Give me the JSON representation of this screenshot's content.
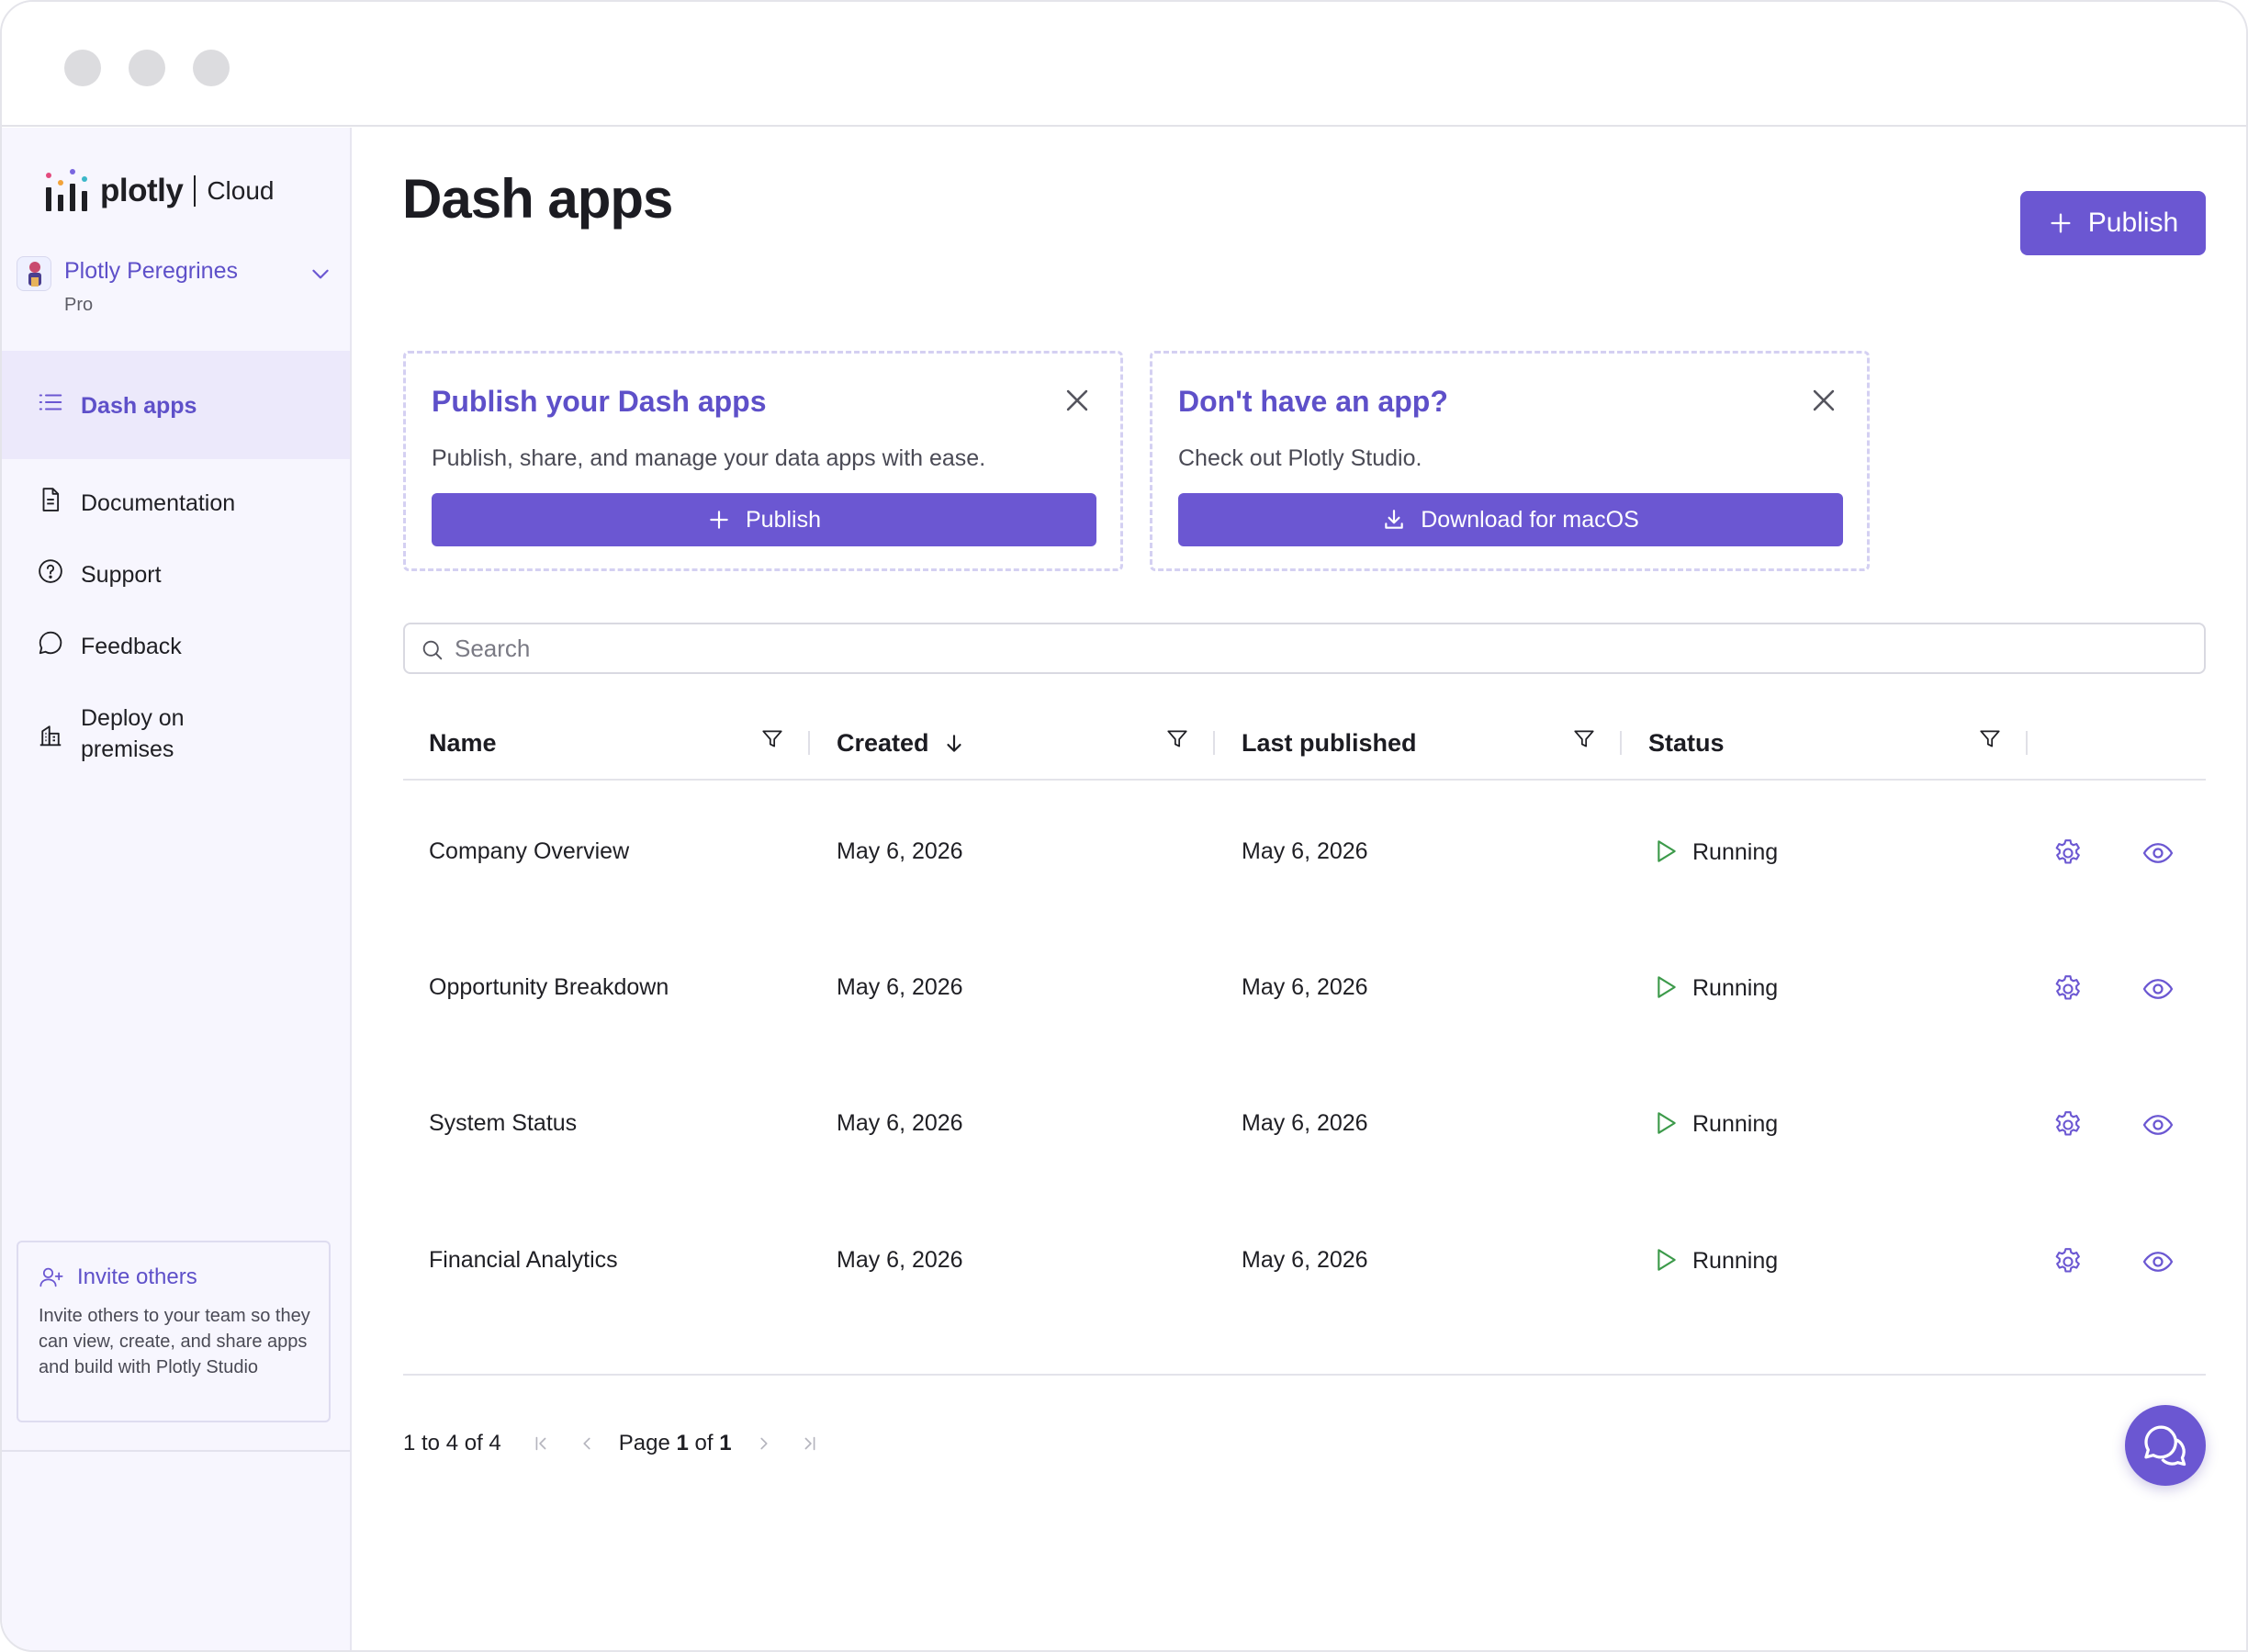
{
  "brand": {
    "logo_word": "plotly",
    "logo_product": "Cloud",
    "accent": "#6b57d2",
    "accent_text": "#5e50c9",
    "running_color": "#3c9a4a"
  },
  "team": {
    "name": "Plotly Peregrines",
    "plan": "Pro"
  },
  "sidebar": {
    "items": [
      {
        "label": "Dash apps",
        "icon": "list-icon"
      },
      {
        "label": "Documentation",
        "icon": "document-icon"
      },
      {
        "label": "Support",
        "icon": "help-circle-icon"
      },
      {
        "label": "Feedback",
        "icon": "chat-bubble-icon"
      },
      {
        "label": "Deploy on premises",
        "icon": "building-icon"
      }
    ],
    "invite": {
      "title": "Invite others",
      "text": "Invite others to your team so they can view, create, and share apps and build with Plotly Studio"
    }
  },
  "header": {
    "title": "Dash apps",
    "publish_label": "Publish"
  },
  "cards": [
    {
      "title": "Publish your Dash apps",
      "text": "Publish, share, and manage your data apps with ease.",
      "button": "Publish",
      "button_icon": "plus-icon"
    },
    {
      "title": "Don't have an app?",
      "text": "Check out Plotly Studio.",
      "button": "Download for macOS",
      "button_icon": "download-icon"
    }
  ],
  "search": {
    "placeholder": "Search",
    "value": ""
  },
  "table": {
    "columns": [
      "Name",
      "Created",
      "Last published",
      "Status"
    ],
    "sort": {
      "column": "Created",
      "direction": "desc"
    },
    "rows": [
      {
        "name": "Company Overview",
        "created": "May 6, 2026",
        "last_published": "May 6, 2026",
        "status": "Running"
      },
      {
        "name": "Opportunity Breakdown",
        "created": "May 6, 2026",
        "last_published": "May 6, 2026",
        "status": "Running"
      },
      {
        "name": "System Status",
        "created": "May 6, 2026",
        "last_published": "May 6, 2026",
        "status": "Running"
      },
      {
        "name": "Financial Analytics",
        "created": "May 6, 2026",
        "last_published": "May 6, 2026",
        "status": "Running"
      }
    ]
  },
  "pagination": {
    "range": "1 to 4 of 4",
    "page_prefix": "Page ",
    "page": "1",
    "page_of": " of ",
    "total_pages": "1"
  }
}
